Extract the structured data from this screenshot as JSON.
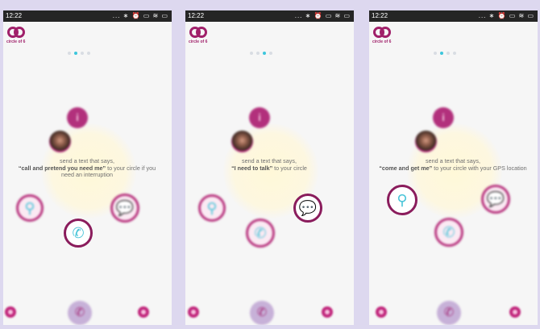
{
  "status_bar": {
    "time": "12:22",
    "icons": "... ∗ ⏰ ▭ ≋ ▭"
  },
  "logo": {
    "text": "circle of 6"
  },
  "colors": {
    "accent": "#b8367f",
    "accent_dark": "#8a1c5c",
    "teal": "#3cc6dc",
    "background": "#ddd8ef"
  },
  "screens": [
    {
      "active_dot": 2,
      "caption_line1": "send a text that says,",
      "caption_bold": "“call and pretend you need me”",
      "caption_rest": " to your circle if you need an interruption",
      "selected_button": "call"
    },
    {
      "active_dot": 2,
      "caption_line1": "send a text that says,",
      "caption_bold": "“I need to talk”",
      "caption_rest": " to your circle",
      "selected_button": "chat"
    },
    {
      "active_dot": 1,
      "caption_line1": "send a text that says,",
      "caption_bold": "“come and get me”",
      "caption_rest": " to your circle with your GPS location",
      "selected_button": "location"
    }
  ],
  "icons": {
    "info": "i",
    "location": "⚲",
    "chat": "💬",
    "call": "✆",
    "call_pink": "✆"
  }
}
